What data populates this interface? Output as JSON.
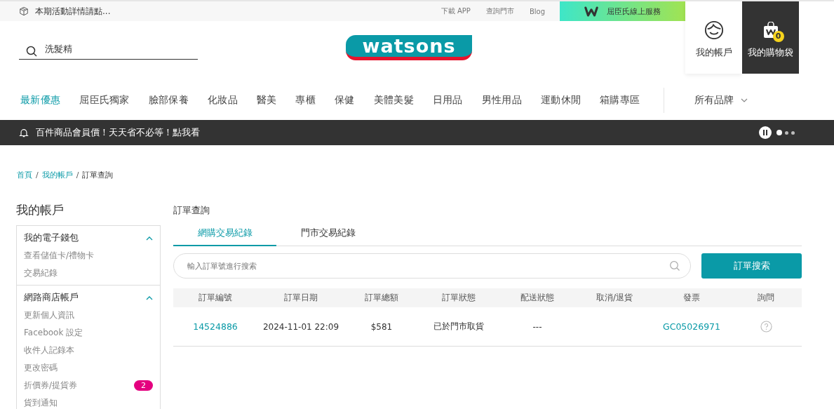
{
  "top_bar": {
    "notice": "本期活動詳情請點...",
    "links": [
      "下載 APP",
      "查詢門市",
      "Blog"
    ],
    "service": "屈臣氏線上服務"
  },
  "header": {
    "search": {
      "value": "洗髮精"
    },
    "logo": "watsons",
    "account": "我的帳戶",
    "bag": {
      "label": "我的購物袋",
      "count": "0"
    }
  },
  "nav": {
    "items": [
      {
        "label": "最新優惠",
        "selected": true
      },
      {
        "label": "屈臣氏獨家",
        "selected": false
      },
      {
        "label": "臉部保養",
        "selected": false
      },
      {
        "label": "化妝品",
        "selected": false
      },
      {
        "label": "醫美",
        "selected": false
      },
      {
        "label": "專櫃",
        "selected": false
      },
      {
        "label": "保健",
        "selected": false
      },
      {
        "label": "美體美髮",
        "selected": false
      },
      {
        "label": "日用品",
        "selected": false
      },
      {
        "label": "男性用品",
        "selected": false
      },
      {
        "label": "運動休閒",
        "selected": false
      },
      {
        "label": "箱購專區",
        "selected": false
      }
    ],
    "brands": "所有品牌"
  },
  "banner": {
    "text": "百件商品會員價！天天省不必等！點我看",
    "slides": [
      {
        "selected": true
      },
      {
        "selected": false
      },
      {
        "selected": false
      }
    ]
  },
  "breadcrumb": [
    {
      "label": "首頁",
      "link": true
    },
    {
      "separator": "/",
      "label": "我的帳戶",
      "link": true
    },
    {
      "separator": "/",
      "label": "訂單查詢",
      "link": false
    }
  ],
  "sidebar": {
    "title": "我的帳戶",
    "sections": [
      {
        "title": "我的電子錢包",
        "expanded": true,
        "items": [
          {
            "label": "查看儲值卡/禮物卡"
          },
          {
            "label": "交易紀錄"
          }
        ]
      },
      {
        "title": "網路商店帳戶",
        "expanded": true,
        "items": [
          {
            "label": "更新個人資訊"
          },
          {
            "label": "Facebook 設定"
          },
          {
            "label": "收件人記錄本"
          },
          {
            "label": "更改密碼"
          },
          {
            "label": "折價券/提貨券",
            "badge": "2"
          },
          {
            "label": "貨到通知"
          }
        ]
      }
    ]
  },
  "main": {
    "title": "訂單查詢",
    "tabs": [
      {
        "label": "網購交易紀錄",
        "selected": true
      },
      {
        "label": "門市交易紀錄",
        "selected": false
      }
    ],
    "search": {
      "placeholder": "輸入訂單號進行搜索"
    },
    "search_button": "訂單搜索",
    "table": {
      "columns": [
        "訂單編號",
        "訂單日期",
        "訂單總額",
        "訂單狀態",
        "配送狀態",
        "取消/退貨",
        "發票",
        "詢問"
      ],
      "rows": [
        {
          "cells": [
            {
              "text": "14524886",
              "kind": "link"
            },
            {
              "text": "2024-11-01 22:09",
              "kind": "text"
            },
            {
              "text": "$581",
              "kind": "text"
            },
            {
              "text": "已於門市取貨",
              "kind": "text"
            },
            {
              "text": "---",
              "kind": "text"
            },
            {
              "kind": "empty"
            },
            {
              "text": "GC05026971",
              "kind": "link"
            },
            {
              "kind": "help"
            }
          ]
        }
      ]
    }
  }
}
